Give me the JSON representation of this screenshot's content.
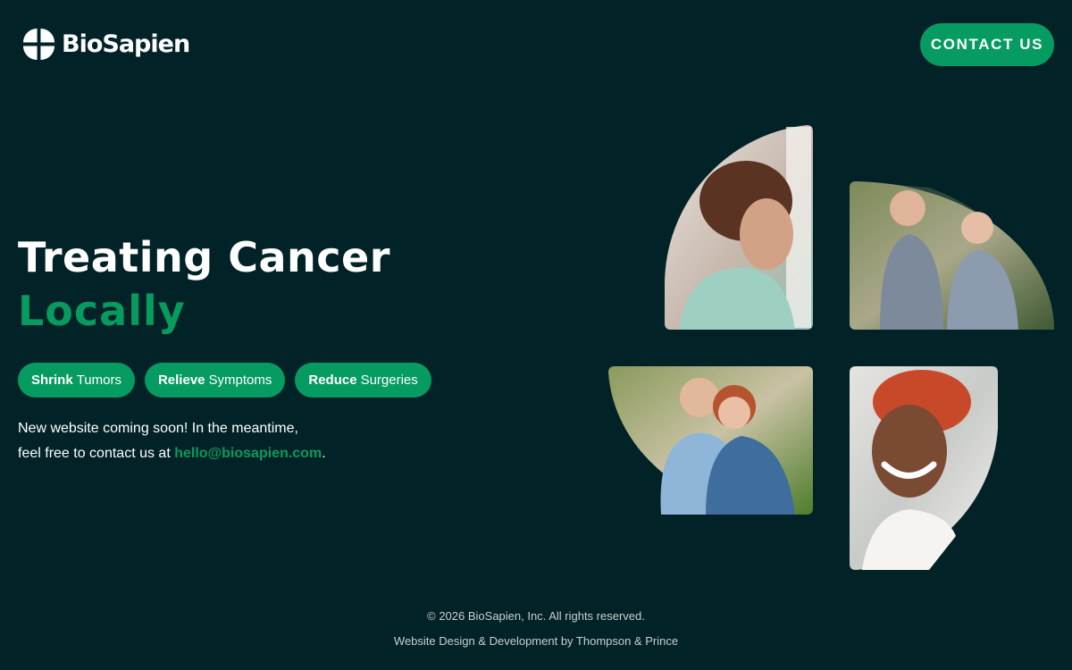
{
  "header": {
    "logo_text": "BioSapien",
    "logo_icon": "biosapien-quad-leaf-logo",
    "contact_label": "CONTACT US"
  },
  "hero": {
    "title_line1": "Treating Cancer",
    "title_line2": "Locally",
    "pills": [
      {
        "strong": "Shrink",
        "rest": "Tumors"
      },
      {
        "strong": "Relieve",
        "rest": "Symptoms"
      },
      {
        "strong": "Reduce",
        "rest": "Surgeries"
      }
    ],
    "note_line1": "New website coming soon! In the meantime,",
    "note_line2_prefix": "feel free to contact us at",
    "email": "hello@biosapien.com",
    "note_suffix": "."
  },
  "photos": [
    {
      "name": "woman-head-wrap-photo"
    },
    {
      "name": "senior-couple-jogging-photo"
    },
    {
      "name": "senior-couple-hugging-photo"
    },
    {
      "name": "smiling-woman-red-headwrap-photo"
    }
  ],
  "footer": {
    "copyright": "© 2026 BioSapien, Inc. All rights reserved.",
    "credit": "Website Design & Development by Thompson & Prince"
  },
  "colors": {
    "background": "#012227",
    "accent_green": "#059b61",
    "text_white": "#ffffff",
    "footer_text": "#c8d0d2"
  }
}
